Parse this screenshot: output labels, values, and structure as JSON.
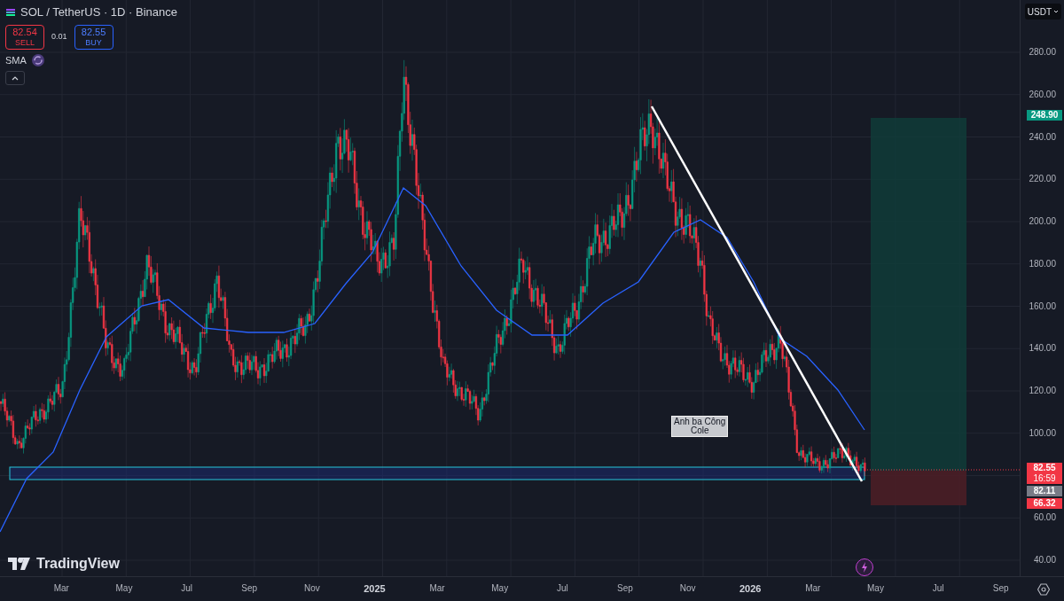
{
  "header": {
    "title": "SOL / TetherUS · 1D · Binance",
    "sell": {
      "price": "82.54",
      "label": "SELL"
    },
    "spread": "0.01",
    "buy": {
      "price": "82.55",
      "label": "BUY"
    },
    "indicator": "SMA"
  },
  "currency": "USDT",
  "price_axis": [
    "280.00",
    "260.00",
    "240.00",
    "220.00",
    "200.00",
    "180.00",
    "160.00",
    "140.00",
    "120.00",
    "100.00",
    "60.00",
    "40.00"
  ],
  "time_axis": [
    {
      "label": "Mar",
      "kind": "month"
    },
    {
      "label": "May",
      "kind": "month"
    },
    {
      "label": "Jul",
      "kind": "month"
    },
    {
      "label": "Sep",
      "kind": "month"
    },
    {
      "label": "Nov",
      "kind": "month"
    },
    {
      "label": "2025",
      "kind": "year"
    },
    {
      "label": "Mar",
      "kind": "month"
    },
    {
      "label": "May",
      "kind": "month"
    },
    {
      "label": "Jul",
      "kind": "month"
    },
    {
      "label": "Sep",
      "kind": "month"
    },
    {
      "label": "Nov",
      "kind": "month"
    },
    {
      "label": "2026",
      "kind": "year"
    },
    {
      "label": "Mar",
      "kind": "month"
    },
    {
      "label": "May",
      "kind": "month"
    },
    {
      "label": "Jul",
      "kind": "month"
    },
    {
      "label": "Sep",
      "kind": "month"
    }
  ],
  "price_badges": [
    {
      "text": "248.90",
      "color": "#089981"
    },
    {
      "text": "82.55",
      "sub": "16:59",
      "color": "#f23645"
    },
    {
      "text": "82.11",
      "color": "#787b86"
    },
    {
      "text": "66.32",
      "color": "#f23645"
    }
  ],
  "annotation": "Anh ba Công\nCole",
  "logo": "TradingView"
}
